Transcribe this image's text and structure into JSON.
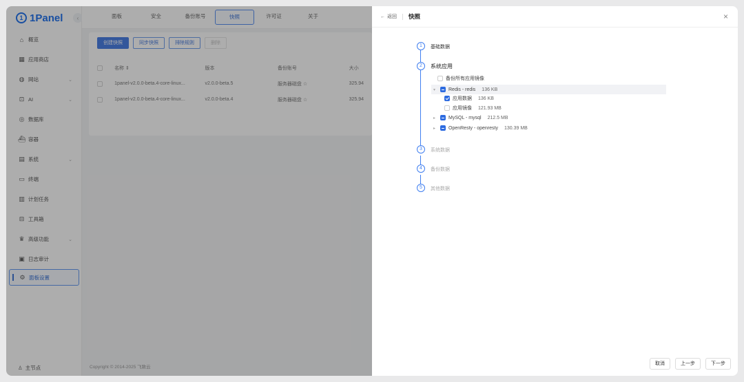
{
  "app": {
    "logo_text": "1Panel",
    "copyright": "Copyright © 2014-2025 飞致云"
  },
  "sidebar": {
    "items": [
      {
        "label": "概览",
        "icon": "home-icon",
        "arrow": false
      },
      {
        "label": "应用商店",
        "icon": "grid-icon",
        "arrow": false
      },
      {
        "label": "网站",
        "icon": "globe-icon",
        "arrow": true
      },
      {
        "label": "AI",
        "icon": "robot-icon",
        "arrow": true
      },
      {
        "label": "数据库",
        "icon": "database-icon",
        "arrow": false
      },
      {
        "label": "容器",
        "icon": "whale-icon",
        "arrow": false
      },
      {
        "label": "系统",
        "icon": "system-icon",
        "arrow": true
      },
      {
        "label": "终端",
        "icon": "terminal-icon",
        "arrow": false
      },
      {
        "label": "计划任务",
        "icon": "calendar-icon",
        "arrow": false
      },
      {
        "label": "工具箱",
        "icon": "toolbox-icon",
        "arrow": false
      },
      {
        "label": "高级功能",
        "icon": "crown-icon",
        "arrow": true
      },
      {
        "label": "日志审计",
        "icon": "log-icon",
        "arrow": false
      },
      {
        "label": "面板设置",
        "icon": "settings-icon",
        "arrow": false,
        "active": true
      }
    ],
    "node_label": "主节点"
  },
  "topnav": {
    "tabs": [
      "面板",
      "安全",
      "备份账号",
      "快照",
      "许可证",
      "关于"
    ],
    "active_index": 3
  },
  "toolbar": {
    "create": "创建快照",
    "sync": "同步快照",
    "exclude": "排除规则",
    "delete": "删除"
  },
  "table": {
    "headers": [
      "名称",
      "版本",
      "备份账号",
      "大小"
    ],
    "rows": [
      {
        "name": "1panel-v2.0.0-beta.4-core-linux...",
        "version": "v2.0.0-beta.5",
        "account": "服务器磁盘",
        "size": "325.94"
      },
      {
        "name": "1panel-v2.0.0-beta.4-core-linux...",
        "version": "v2.0.0-beta.4",
        "account": "服务器磁盘",
        "size": "325.94"
      }
    ]
  },
  "drawer": {
    "back_label": "返回",
    "title": "快照",
    "steps": [
      {
        "num": "1",
        "label": "基础数据"
      },
      {
        "num": "2",
        "label": "系统应用"
      },
      {
        "num": "3",
        "label": "系统数据"
      },
      {
        "num": "4",
        "label": "备份数据"
      },
      {
        "num": "5",
        "label": "其他数据"
      }
    ],
    "backup_all_images": "备份所有应用镜像",
    "tree": {
      "redis": {
        "label": "Redis - redis",
        "size": "136 KB"
      },
      "redis_data": {
        "label": "应用数据",
        "size": "136 KB"
      },
      "redis_image": {
        "label": "应用镜像",
        "size": "121.93 MB"
      },
      "mysql": {
        "label": "MySQL - mysql",
        "size": "212.5 MB"
      },
      "openresty": {
        "label": "OpenResty - openresty",
        "size": "130.39 MB"
      }
    },
    "buttons": {
      "cancel": "取消",
      "prev": "上一步",
      "next": "下一步"
    }
  },
  "colors": {
    "brand": "#005eeb",
    "accent": "#2d6be0"
  }
}
